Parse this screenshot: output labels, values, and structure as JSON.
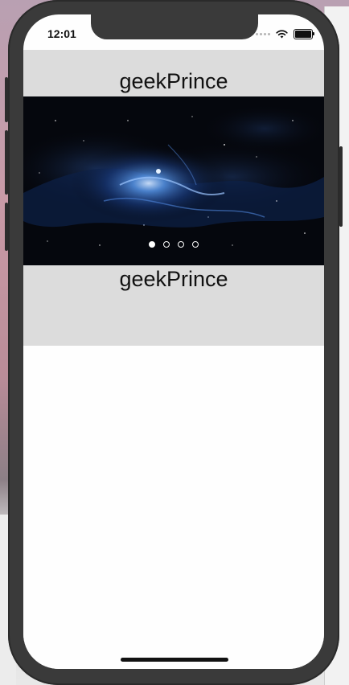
{
  "status_bar": {
    "time": "12:01",
    "icons": [
      "signal-dots-icon",
      "wifi-icon",
      "battery-icon"
    ]
  },
  "header": {
    "title_top": "geekPrince",
    "title_bottom": "geekPrince"
  },
  "banner": {
    "image_subject": "blue nebula in space",
    "pages": 4,
    "active_page": 1
  },
  "colors": {
    "header_background": "#dcdcdc",
    "content_background": "#fefefe",
    "banner_background": "#05070d",
    "nebula_blue": "#3f7fe0"
  }
}
